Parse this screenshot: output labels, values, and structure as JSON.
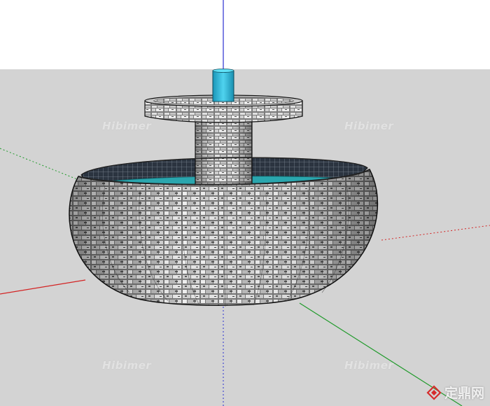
{
  "scene": {
    "sky_color": "#ffffff",
    "ground_color": "#d3d3d3",
    "axis_colors": {
      "x": "#d32424",
      "y": "#1f9a2a",
      "z": "#2a2fd0"
    },
    "object": {
      "stone_color": "#8d8d8d",
      "water_color": "#2aa6ae",
      "tile_color": "#2c3540",
      "pipe_color": "#2ab7d6"
    }
  },
  "watermarks": [
    "Hibimer",
    "Hibimer",
    "Hibimer",
    "Hibimer"
  ],
  "brand": {
    "text": "定鼎网",
    "icon": "diamond-logo-icon"
  }
}
